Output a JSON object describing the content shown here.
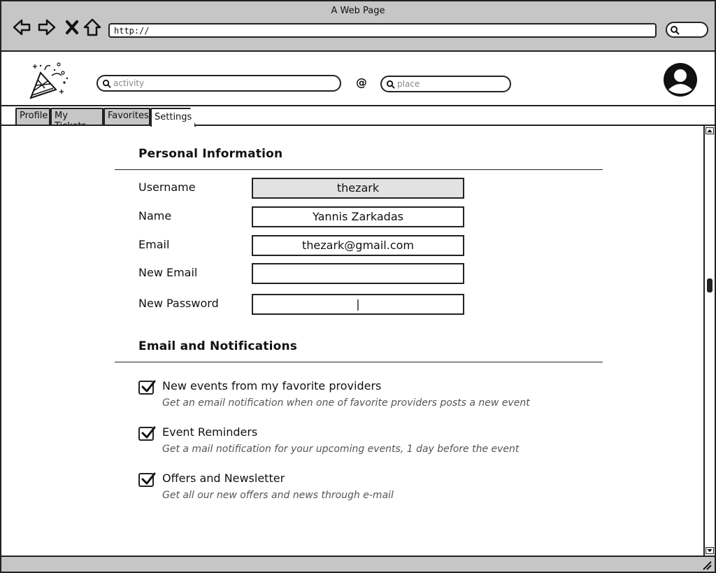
{
  "window": {
    "title": "A Web Page"
  },
  "browser": {
    "url": "http://"
  },
  "header": {
    "activity_placeholder": "activity",
    "at": "@",
    "place_placeholder": "place"
  },
  "tabs": [
    {
      "label": "Profile",
      "active": false
    },
    {
      "label": "My Tickets",
      "active": false
    },
    {
      "label": "Favorites",
      "active": false
    },
    {
      "label": "Settings",
      "active": true
    }
  ],
  "personal": {
    "title": "Personal Information",
    "fields": [
      {
        "label": "Username",
        "value": "thezark",
        "readonly": true
      },
      {
        "label": "Name",
        "value": "Yannis Zarkadas"
      },
      {
        "label": "Email",
        "value": "thezark@gmail.com"
      },
      {
        "label": "New Email",
        "value": ""
      },
      {
        "label": "New Password",
        "value": "|"
      }
    ]
  },
  "notifications": {
    "title": "Email and Notifications",
    "items": [
      {
        "label": "New events from my favorite providers",
        "description": "Get an email notification when one of favorite providers posts a new event",
        "checked": true
      },
      {
        "label": "Event Reminders",
        "description": "Get a mail notification for your upcoming events, 1 day before the event",
        "checked": true
      },
      {
        "label": "Offers and Newsletter",
        "description": "Get all our new offers and news through e-mail",
        "checked": true
      }
    ]
  }
}
